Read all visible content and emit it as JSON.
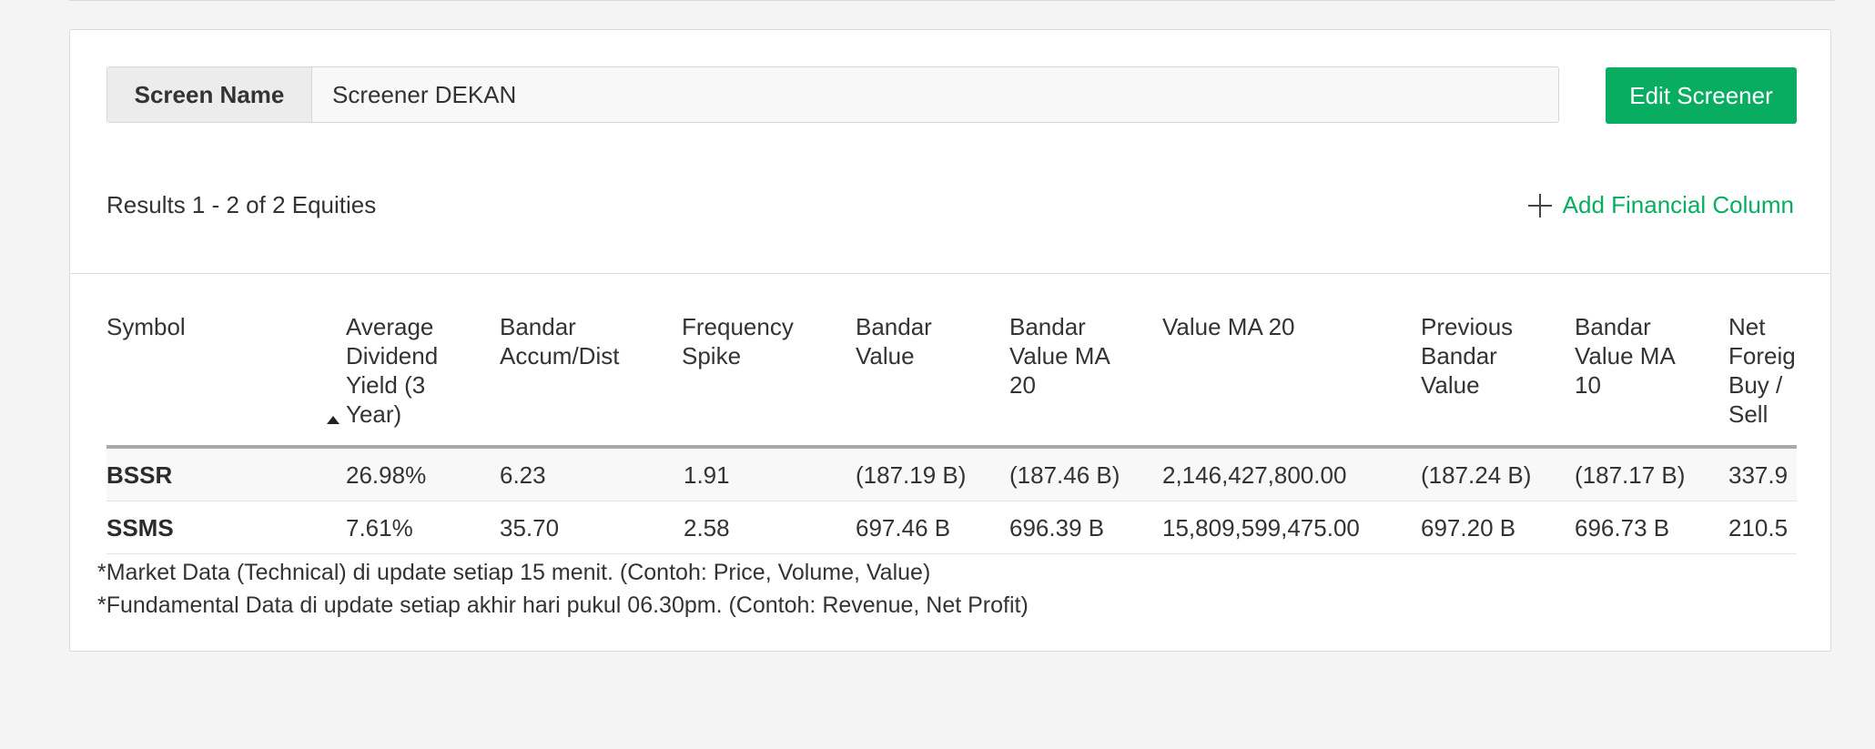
{
  "screen": {
    "label": "Screen Name",
    "value": "Screener DEKAN",
    "edit_button": "Edit Screener"
  },
  "results": {
    "summary": "Results 1 - 2 of 2 Equities",
    "add_column": "Add Financial Column"
  },
  "table": {
    "columns": [
      "Symbol",
      "Average Dividend Yield (3 Year)",
      "Bandar Accum/Dist",
      "Frequency Spike",
      "Bandar Value",
      "Bandar Value MA 20",
      "Value MA 20",
      "Previous Bandar Value",
      "Bandar Value MA 10",
      "Net Foreign Buy / Sell"
    ],
    "sorted_column": "Average Dividend Yield (3 Year)",
    "sort_direction": "ascending",
    "rows": [
      [
        "BSSR",
        "26.98%",
        "6.23",
        "1.91",
        "(187.19 B)",
        "(187.46 B)",
        "2,146,427,800.00",
        "(187.24 B)",
        "(187.17 B)",
        "337.9"
      ],
      [
        "SSMS",
        "7.61%",
        "35.70",
        "2.58",
        "697.46 B",
        "696.39 B",
        "15,809,599,475.00",
        "697.20 B",
        "696.73 B",
        "210.5"
      ]
    ]
  },
  "footnotes": [
    "*Market Data (Technical) di update setiap 15 menit. (Contoh: Price, Volume, Value)",
    "*Fundamental Data di update setiap akhir hari pukul 06.30pm. (Contoh: Revenue, Net Profit)"
  ],
  "colors": {
    "accent": "#08ad61",
    "background": "#f4f4f4"
  }
}
